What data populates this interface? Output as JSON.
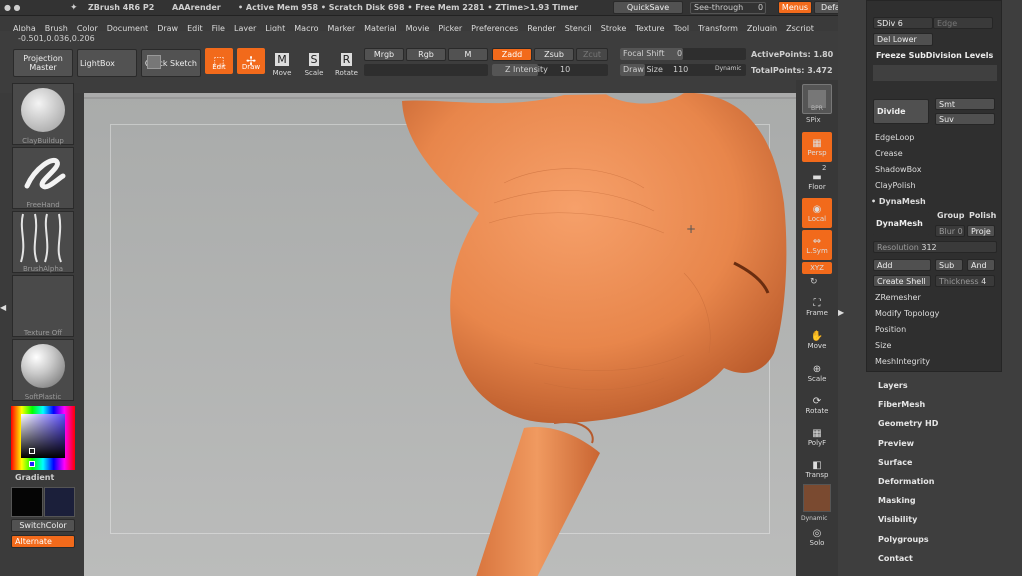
{
  "titlebar": {
    "app": "ZBrush 4R6 P2",
    "render": "AAArender",
    "mem": "• Active Mem 958 • Scratch Disk 698 • Free Mem 2281 • ZTime>1.93 Timer",
    "quicksave": "QuickSave",
    "seethrough": "See-through",
    "seethrough_val": "0",
    "menus": "Menus",
    "script": "DefaultZScript"
  },
  "menus": [
    "Alpha",
    "Brush",
    "Color",
    "Document",
    "Draw",
    "Edit",
    "File",
    "Layer",
    "Light",
    "Macro",
    "Marker",
    "Material",
    "Movie",
    "Picker",
    "Preferences",
    "Render",
    "Stencil",
    "Stroke",
    "Texture",
    "Tool",
    "Transform",
    "Zplugin",
    "Zscript"
  ],
  "coords": "-0.501,0.036,0.206",
  "toolbar": {
    "projection_master": "Projection Master",
    "lightbox": "LightBox",
    "quick_sketch": "Quick Sketch",
    "edit": "Edit",
    "draw": "Draw",
    "move": "Move",
    "scale": "Scale",
    "rotate": "Rotate",
    "mrgb": "Mrgb",
    "rgb": "Rgb",
    "m": "M",
    "zadd": "Zadd",
    "zsub": "Zsub",
    "zcut": "Zcut",
    "z_intensity": "Z Intensity",
    "z_intensity_val": "10",
    "focal_shift": "Focal Shift",
    "focal_shift_val": "0",
    "draw_size": "Draw Size",
    "draw_size_val": "110",
    "dynamic": "Dynamic",
    "active_points": "ActivePoints: 1.80",
    "total_points": "TotalPoints: 3.472"
  },
  "left": {
    "brush": "ClayBuildup",
    "stroke": "FreeHand",
    "alpha": "BrushAlpha",
    "texture": "Texture Off",
    "material": "SoftPlastic",
    "gradient": "Gradient",
    "switch_color": "SwitchColor",
    "alternate": "Alternate"
  },
  "right_shelf": {
    "bpr": "BPR",
    "spix": "SPix",
    "spix_val": "2",
    "persp": "Persp",
    "floor": "Floor",
    "local": "Local",
    "lsym": "L.Sym",
    "xyz": "XYZ",
    "frame": "Frame",
    "move": "Move",
    "scale": "Scale",
    "rotate": "Rotate",
    "polyf": "PolyF",
    "transp": "Transp",
    "dynamic": "Dynamic",
    "solo": "Solo"
  },
  "geometry": {
    "sdiv": "SDiv",
    "sdiv_val": "6",
    "edge": "Edge",
    "del_lower": "Del Lower",
    "freeze": "Freeze SubDivision Levels",
    "divide": "Divide",
    "smt": "Smt",
    "suv": "Suv",
    "edgeloop": "EdgeLoop",
    "crease": "Crease",
    "shadowbox": "ShadowBox",
    "claypolish": "ClayPolish",
    "dynamesh_section": "DynaMesh",
    "dynamesh_btn": "DynaMesh",
    "group": "Group",
    "polish": "Polish",
    "blur": "Blur",
    "blur_val": "0",
    "project": "Proje",
    "resolution": "Resolution",
    "resolution_val": "312",
    "add": "Add",
    "sub": "Sub",
    "and": "And",
    "create_shell": "Create Shell",
    "thickness": "Thickness",
    "thickness_val": "4",
    "zremesher": "ZRemesher",
    "modify_topology": "Modify Topology",
    "position": "Position",
    "size": "Size",
    "meshintegrity": "MeshIntegrity"
  },
  "tool_sections": [
    "Layers",
    "FiberMesh",
    "Geometry HD",
    "Preview",
    "Surface",
    "Deformation",
    "Masking",
    "Visibility",
    "Polygroups",
    "Contact"
  ],
  "colors": {
    "accent": "#f26a1b",
    "skin": "#e8864b",
    "panel": "#3e3e3e"
  }
}
